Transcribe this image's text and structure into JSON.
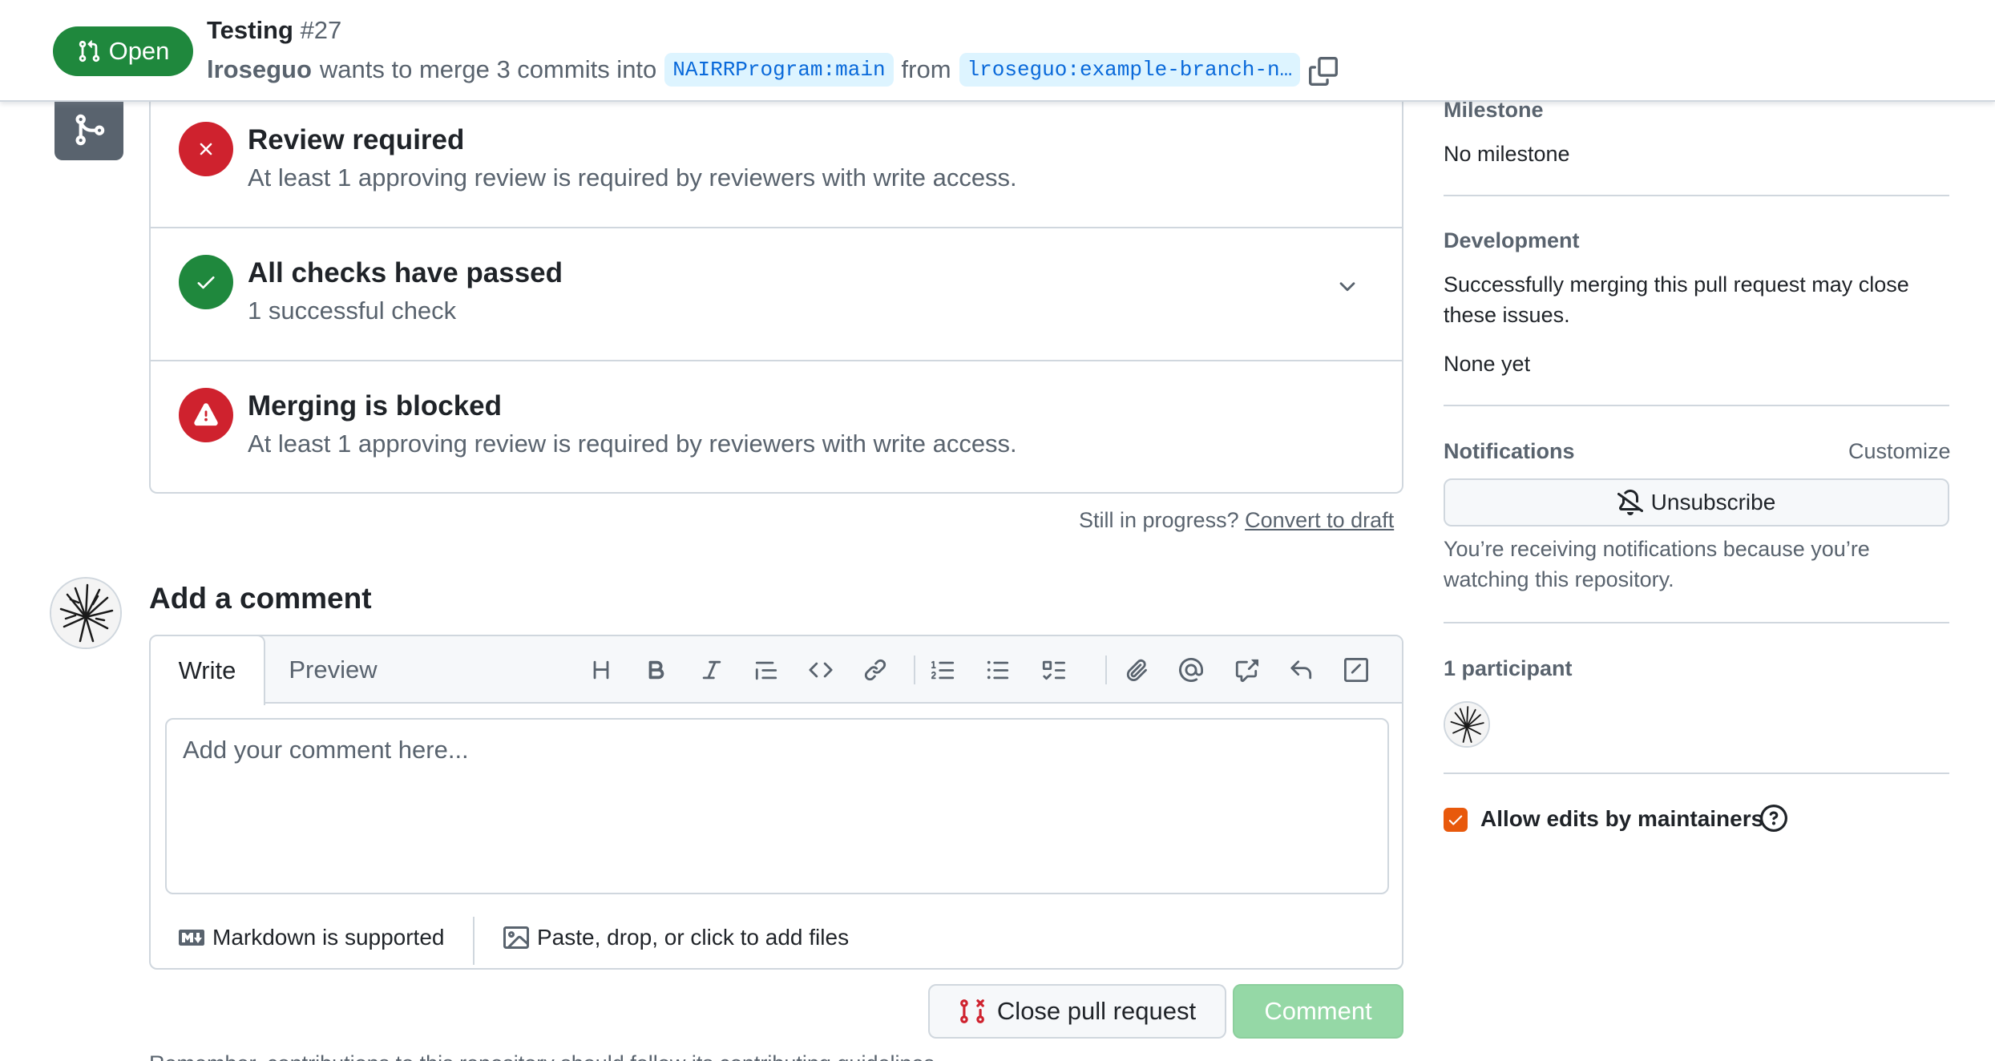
{
  "header": {
    "state_label": "Open",
    "title": "Testing",
    "number": "#27",
    "author": "lroseguo",
    "merge_text": "wants to merge 3 commits into",
    "base_branch": "NAIRRProgram:main",
    "from_text": "from",
    "head_branch": "lroseguo:example-branch-n…"
  },
  "merge_box": {
    "review": {
      "title": "Review required",
      "desc": "At least 1 approving review is required by reviewers with write access."
    },
    "checks": {
      "title": "All checks have passed",
      "desc": "1 successful check"
    },
    "blocked": {
      "title": "Merging is blocked",
      "desc": "At least 1 approving review is required by reviewers with write access."
    }
  },
  "draft": {
    "question": "Still in progress?",
    "link": "Convert to draft"
  },
  "comment": {
    "heading": "Add a comment",
    "tab_write": "Write",
    "tab_preview": "Preview",
    "placeholder": "Add your comment here...",
    "markdown_hint": "Markdown is supported",
    "attach_hint": "Paste, drop, or click to add files",
    "close_button": "Close pull request",
    "comment_button": "Comment",
    "bottom_text": "Remember, contributions to this repository should follow its contributing guidelines."
  },
  "toolbar_icons": [
    "heading-icon",
    "bold-icon",
    "italic-icon",
    "quote-icon",
    "code-icon",
    "link-icon",
    "numbered-list-icon",
    "unordered-list-icon",
    "task-list-icon",
    "attach-icon",
    "mention-icon",
    "cross-reference-icon",
    "reply-icon",
    "slash-commands-icon"
  ],
  "sidebar": {
    "milestone_heading": "Milestone",
    "milestone_value": "No milestone",
    "development_heading": "Development",
    "development_line1": "Successfully merging this pull request may close",
    "development_line2": "these issues.",
    "development_value": "None yet",
    "notifications_heading": "Notifications",
    "customize": "Customize",
    "unsubscribe": "Unsubscribe",
    "notif_line1": "You’re receiving notifications because you’re",
    "notif_line2": "watching this repository.",
    "participants_heading": "1 participant",
    "allow_edits": "Allow edits by maintainers"
  },
  "colors": {
    "open_green": "#1f883d",
    "danger_red": "#cf222e",
    "success_green": "#1f883d",
    "checkbox_orange": "#e8590c",
    "link_blue": "#0969da"
  }
}
